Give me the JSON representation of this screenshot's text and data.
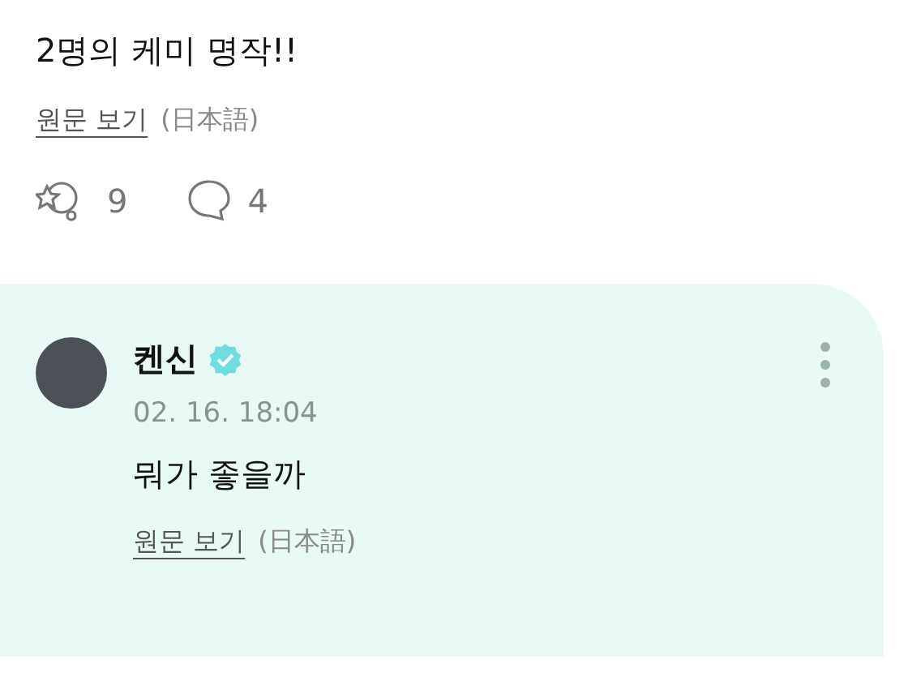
{
  "post": {
    "text": "2명의 케미 명작!!",
    "original_link": "원문 보기",
    "language": "(日本語)",
    "reactions": "9",
    "comments": "4"
  },
  "comment": {
    "author": "켄신",
    "verified": true,
    "time": "02. 16. 18:04",
    "text": "뭐가 좋을까",
    "original_link": "원문 보기",
    "language": "(日本語)"
  }
}
